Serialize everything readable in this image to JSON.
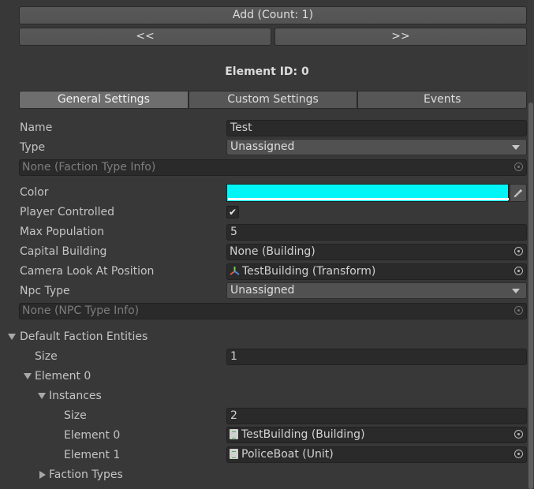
{
  "toolbar": {
    "add_label": "Add (Count: 1)",
    "prev_label": "<<",
    "next_label": ">>"
  },
  "element_title": "Element ID: 0",
  "tabs": [
    {
      "label": "General Settings",
      "active": true
    },
    {
      "label": "Custom Settings",
      "active": false
    },
    {
      "label": "Events",
      "active": false
    }
  ],
  "properties": {
    "name": {
      "label": "Name",
      "value": "Test"
    },
    "type": {
      "label": "Type",
      "value": "Unassigned"
    },
    "faction_type_info": {
      "value": "None (Faction Type Info)"
    },
    "color": {
      "label": "Color",
      "value": "#00f6f6"
    },
    "player_controlled": {
      "label": "Player Controlled",
      "checked": true,
      "glyph": "✔"
    },
    "max_population": {
      "label": "Max Population",
      "value": "5"
    },
    "capital_building": {
      "label": "Capital Building",
      "value": "None (Building)"
    },
    "camera_look_at": {
      "label": "Camera Look At Position",
      "value": "TestBuilding (Transform)"
    },
    "npc_type": {
      "label": "Npc Type",
      "value": "Unassigned"
    },
    "npc_type_info": {
      "value": "None (NPC Type Info)"
    }
  },
  "default_faction_entities": {
    "label": "Default Faction Entities",
    "size_label": "Size",
    "size_value": "1",
    "element0": {
      "label": "Element 0",
      "instances": {
        "label": "Instances",
        "size_label": "Size",
        "size_value": "2",
        "items": [
          {
            "label": "Element 0",
            "value": "TestBuilding (Building)"
          },
          {
            "label": "Element 1",
            "value": "PoliceBoat (Unit)"
          }
        ]
      },
      "faction_types_label": "Faction Types"
    }
  },
  "icons": {
    "picker": "object-picker-icon",
    "eyedropper": "eyedropper-icon",
    "transform": "transform-icon",
    "script": "script-icon"
  }
}
